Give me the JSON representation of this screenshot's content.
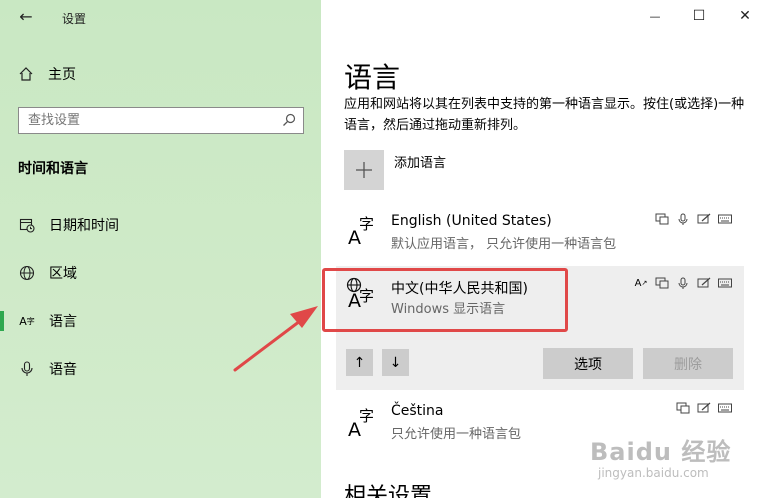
{
  "window": {
    "title": "设置",
    "back_glyph": "←",
    "minimize_glyph": "—",
    "maximize_glyph": "☐",
    "close_glyph": "✕"
  },
  "sidebar": {
    "home_label": "主页",
    "search_placeholder": "查找设置",
    "section_title": "时间和语言",
    "items": [
      {
        "label": "日期和时间",
        "icon": "calendar-clock-icon"
      },
      {
        "label": "区域",
        "icon": "globe-icon"
      },
      {
        "label": "语言",
        "icon": "language-icon",
        "active": true
      },
      {
        "label": "语音",
        "icon": "microphone-icon"
      }
    ],
    "accent_color": "#2fa84f"
  },
  "main": {
    "title": "语言",
    "description": "应用和网站将以其在列表中支持的第一种语言显示。按住(或选择)一种语言，然后通过拖动重新排列。",
    "add_language_label": "添加语言",
    "languages": [
      {
        "name": "English (United States)",
        "subtitle": "默认应用语言， 只允许使用一种语言包",
        "glyph_a": "A",
        "glyph_zi": "字"
      },
      {
        "name": "中文(中华人民共和国)",
        "subtitle": "Windows 显示语言",
        "glyph_a": "A",
        "glyph_zi": "字"
      },
      {
        "name": "Čeština",
        "subtitle": "只允许使用一种语言包",
        "glyph_a": "A",
        "glyph_zi": "字"
      }
    ],
    "move_up_glyph": "↑",
    "move_down_glyph": "↓",
    "options_label": "选项",
    "remove_label": "删除",
    "related_settings_heading": "相关设置"
  },
  "annotation": {
    "highlight_color": "#e04848"
  },
  "watermark": {
    "main": "Baidu 经验",
    "sub": "jingyan.baidu.com"
  }
}
